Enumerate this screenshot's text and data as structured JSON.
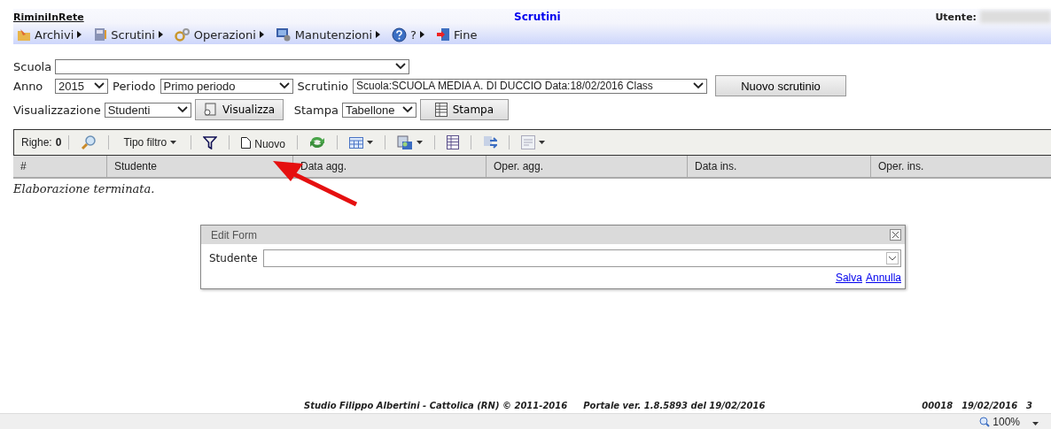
{
  "header": {
    "app_name": "RiminiInRete",
    "title": "Scrutini",
    "user_label": "Utente:"
  },
  "menu": [
    {
      "label": "Archivi",
      "submenu": true
    },
    {
      "label": "Scrutini",
      "submenu": true
    },
    {
      "label": "Operazioni",
      "submenu": true
    },
    {
      "label": "Manutenzioni",
      "submenu": true
    },
    {
      "label": "?",
      "submenu": true
    },
    {
      "label": "Fine",
      "submenu": false
    }
  ],
  "filters": {
    "scuola": {
      "label": "Scuola"
    },
    "anno": {
      "label": "Anno",
      "value": "2015"
    },
    "periodo": {
      "label": "Periodo",
      "value": "Primo periodo"
    },
    "scrutinio": {
      "label": "Scrutinio",
      "value": "Scuola:SCUOLA MEDIA A. DI DUCCIO Data:18/02/2016 Class"
    },
    "new_button": "Nuovo scrutinio",
    "visualizzazione": {
      "label": "Visualizzazione",
      "value": "Studenti",
      "button": "Visualizza"
    },
    "stampa": {
      "label": "Stampa",
      "value": "Tabellone",
      "button": "Stampa"
    }
  },
  "toolbar": {
    "rows_label": "Righe:",
    "rows_count": "0",
    "items": [
      {
        "kind": "search",
        "dropdown": false
      },
      {
        "kind": "text",
        "label": "Tipo filtro",
        "dropdown": true
      },
      {
        "kind": "filter",
        "dropdown": false
      },
      {
        "kind": "document",
        "label": "Nuovo",
        "dropdown": false
      },
      {
        "kind": "refresh",
        "dropdown": false
      },
      {
        "kind": "grid",
        "dropdown": true
      },
      {
        "kind": "export",
        "dropdown": true
      },
      {
        "kind": "columns",
        "dropdown": false
      },
      {
        "kind": "transfer",
        "dropdown": false
      },
      {
        "kind": "form",
        "dropdown": true
      }
    ]
  },
  "table": {
    "columns": [
      "#",
      "Studente",
      "Data agg.",
      "Oper. agg.",
      "Data ins.",
      "Oper. ins."
    ]
  },
  "status_message": "Elaborazione terminata.",
  "edit_form": {
    "title": "Edit Form",
    "field_label": "Studente",
    "links": [
      "Salva",
      "Annulla"
    ]
  },
  "footer": {
    "credits": "Studio Filippo Albertini - Cattolica (RN) © 2011-2016",
    "version": "Portale ver. 1.8.5893 del 19/02/2016",
    "code": "00018",
    "date": "19/02/2016",
    "extra": "3"
  },
  "zoom": "100%"
}
